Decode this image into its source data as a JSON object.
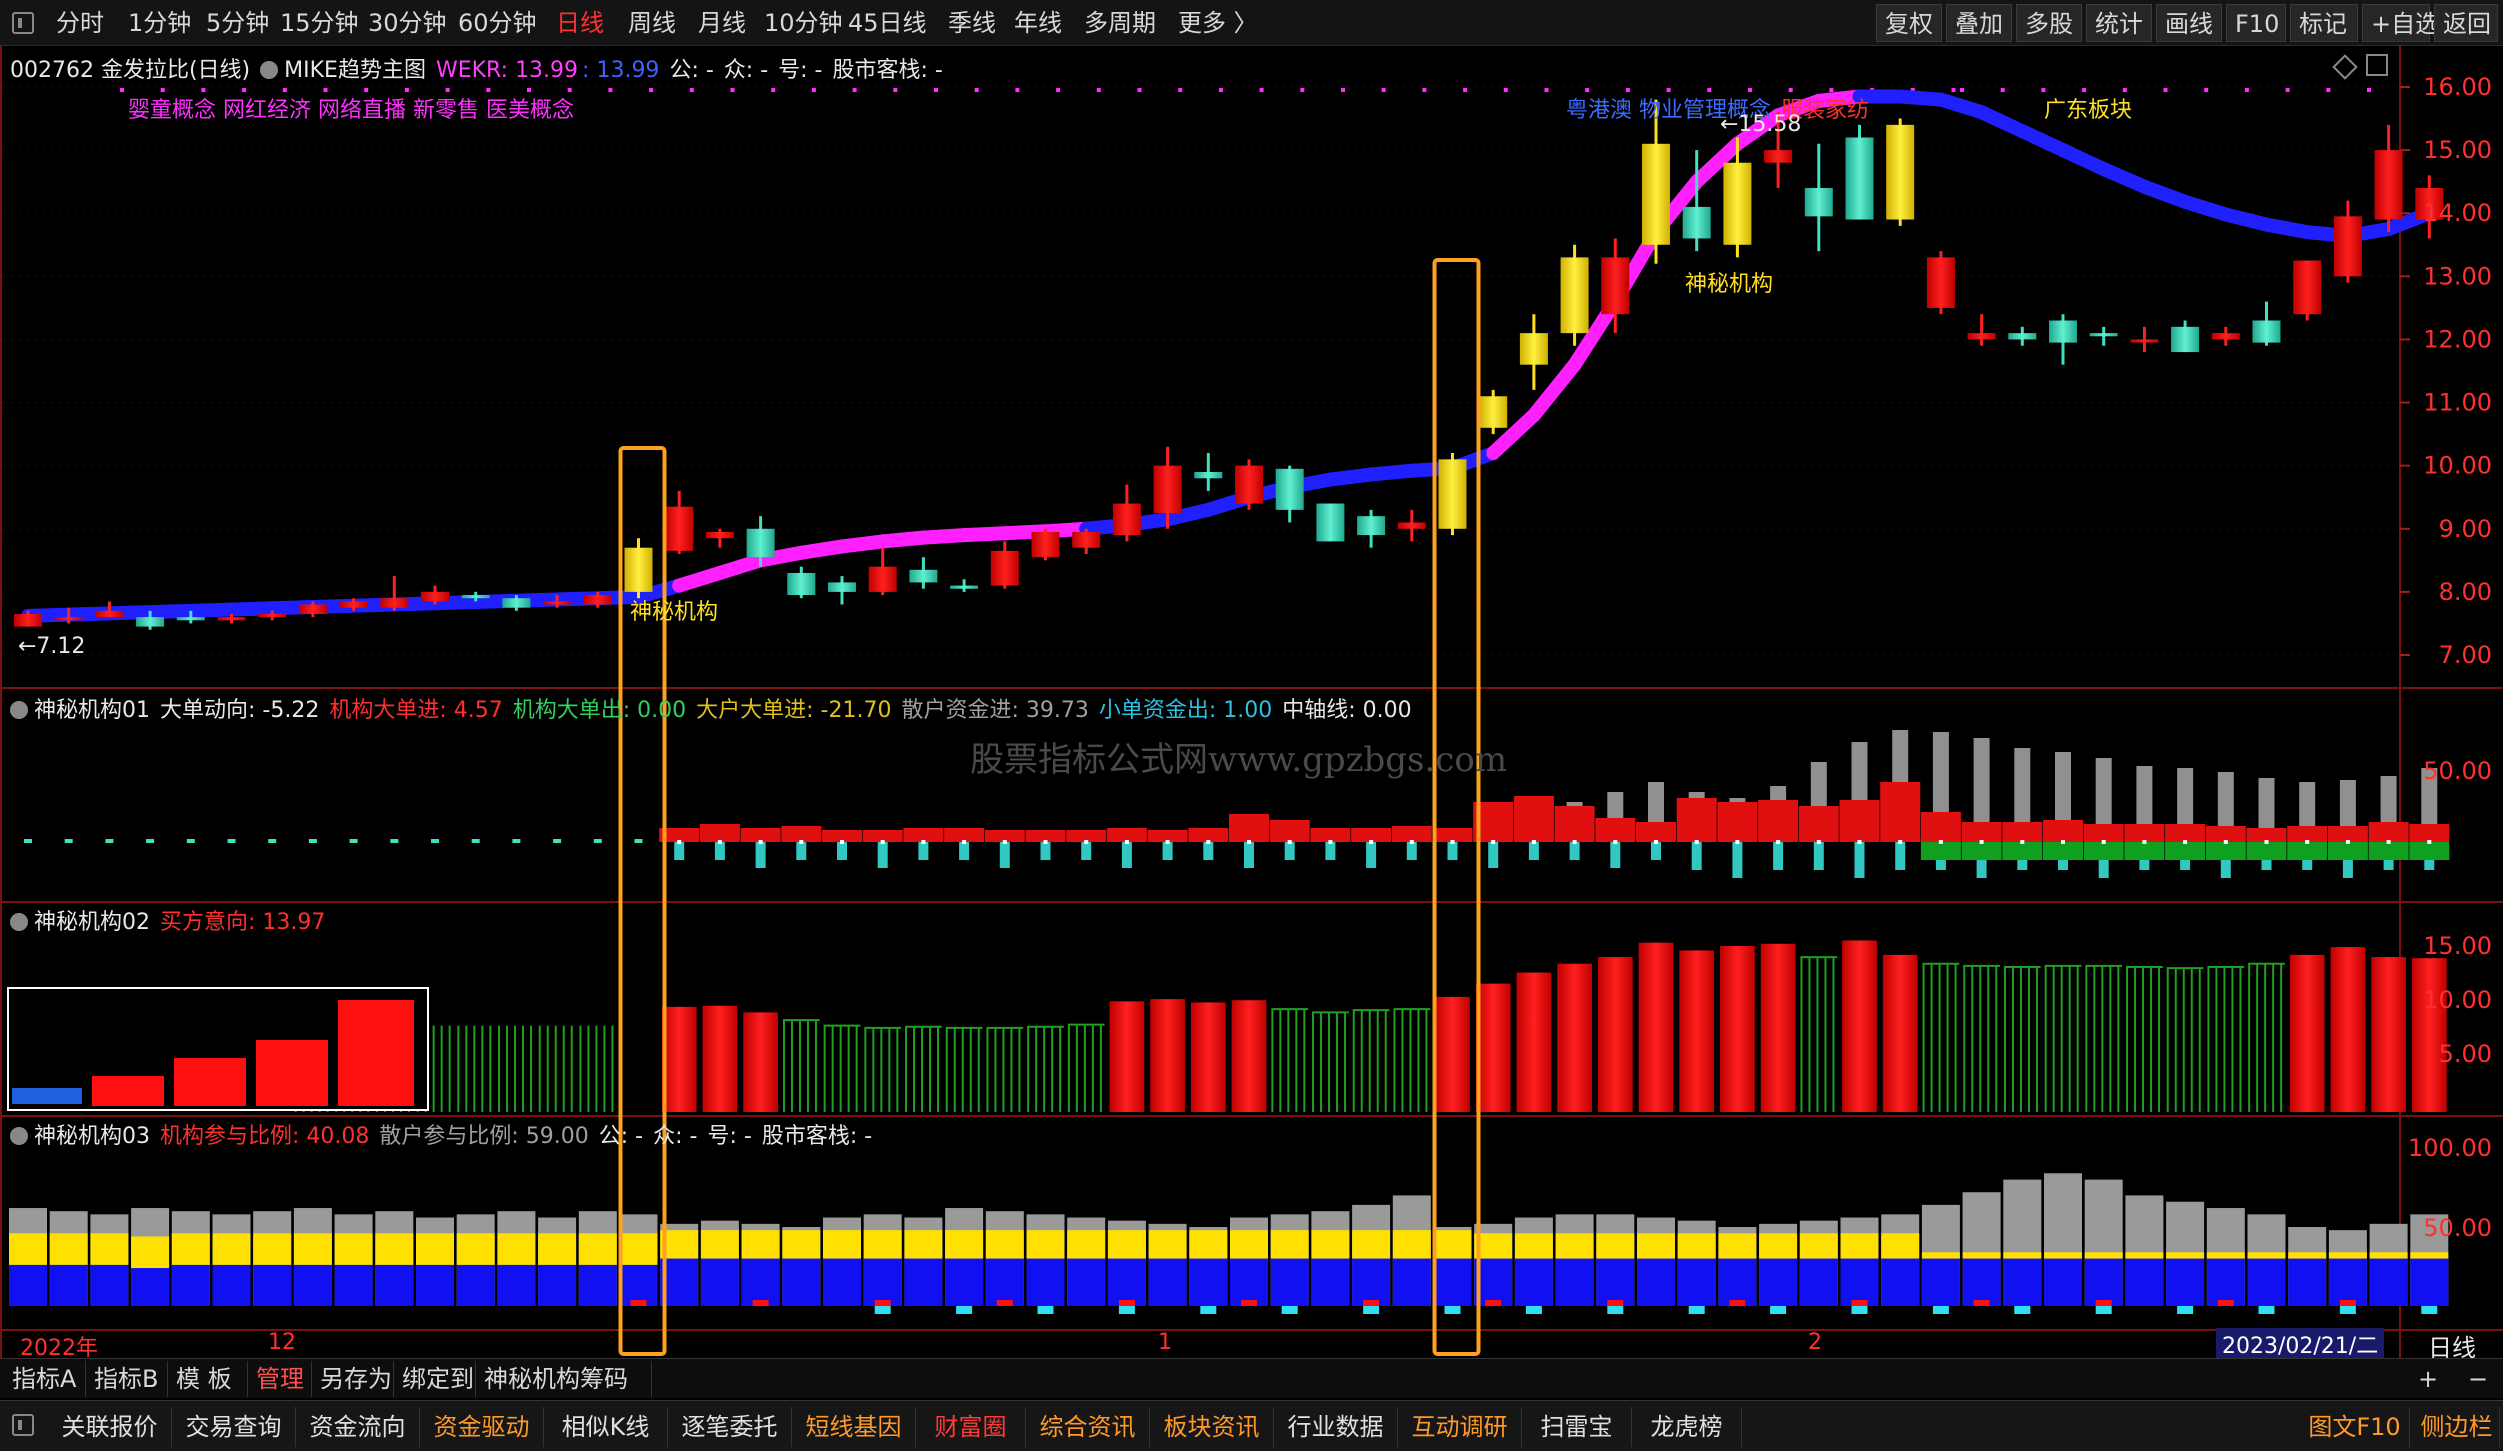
{
  "toolbar": {
    "periods": [
      "分时",
      "1分钟",
      "5分钟",
      "15分钟",
      "30分钟",
      "60分钟",
      "日线",
      "周线",
      "月线",
      "10分钟",
      "45日线",
      "季线",
      "年线",
      "多周期",
      "更多 〉"
    ],
    "active_period": "日线",
    "right_buttons": [
      "复权",
      "叠加",
      "多股",
      "统计",
      "画线",
      "F10",
      "标记",
      "+自选",
      "返回"
    ]
  },
  "main_panel": {
    "code_title": "002762 金发拉比(日线)",
    "indicator_name": "MIKE趋势主图",
    "wekr_label": "WEKR: 13.99",
    "wekr_value2": ": 13.99",
    "extra_labels": [
      "公: -",
      "众: -",
      "号: -",
      "股市客栈: -"
    ],
    "concepts_left": "婴童概念 网红经济 网络直播 新零售 医美概念",
    "concepts_right_blue": "粤港澳 物业管理概念",
    "concepts_right_red": "服装家纺",
    "concepts_right_yellow": "广东板块",
    "mark_high": "←15.58",
    "mark_low": "←7.12",
    "annotation": "神秘机构",
    "y_ticks": [
      "16.00",
      "15.00",
      "14.00",
      "13.00",
      "12.00",
      "11.00",
      "10.00",
      "9.00",
      "8.00",
      "7.00"
    ],
    "colors": {
      "up": "#ff1a1a",
      "down": "#40e0c0",
      "yellow": "#ffe020",
      "trend_blue": "#2020ff",
      "trend_magenta": "#ff20ff"
    }
  },
  "panel1": {
    "name": "神秘机构01",
    "fields": [
      {
        "label": "大单动向: -5.22",
        "color": "#e8e8e8"
      },
      {
        "label": "机构大单进: 4.57",
        "color": "#ff3030"
      },
      {
        "label": "机构大单出: 0.00",
        "color": "#30d060"
      },
      {
        "label": "大户大单进: -21.70",
        "color": "#e0c020"
      },
      {
        "label": "散户资金进: 39.73",
        "color": "#a0a0a0"
      },
      {
        "label": "小单资金出: 1.00",
        "color": "#30c0e0"
      },
      {
        "label": "中轴线: 0.00",
        "color": "#e8e8e8"
      }
    ],
    "y_ticks": [
      "50.00"
    ],
    "watermark": "股票指标公式网www.gpzbgs.com"
  },
  "panel2": {
    "name": "神秘机构02",
    "field": "买方意向: 13.97",
    "y_ticks": [
      "15.00",
      "10.00",
      "5.00"
    ]
  },
  "panel3": {
    "name": "神秘机构03",
    "fields": [
      {
        "label": "机构参与比例: 40.08",
        "color": "#ff3030"
      },
      {
        "label": "散户参与比例: 59.00",
        "color": "#a0a0a0"
      },
      {
        "label": "公: -",
        "color": "#e8e8e8"
      },
      {
        "label": "众: -",
        "color": "#e8e8e8"
      },
      {
        "label": "号: -",
        "color": "#e8e8e8"
      },
      {
        "label": "股市客栈: -",
        "color": "#e8e8e8"
      }
    ],
    "y_ticks": [
      "100.00",
      "50.00"
    ]
  },
  "time_axis": {
    "labels": [
      "2022年",
      "12",
      "1",
      "2"
    ],
    "current_date": "2023/02/21/二",
    "period": "日线"
  },
  "tabs": {
    "items": [
      "指标A",
      "指标B",
      "模 板",
      "管理",
      "另存为",
      "绑定到",
      "神秘机构筹码"
    ],
    "active": "管理"
  },
  "bottom_buttons": {
    "items": [
      {
        "label": "关联报价",
        "style": "normal"
      },
      {
        "label": "交易查询",
        "style": "normal"
      },
      {
        "label": "资金流向",
        "style": "normal"
      },
      {
        "label": "资金驱动",
        "style": "orange"
      },
      {
        "label": "相似K线",
        "style": "normal"
      },
      {
        "label": "逐笔委托",
        "style": "normal"
      },
      {
        "label": "短线基因",
        "style": "orange"
      },
      {
        "label": "财富圈",
        "style": "red"
      },
      {
        "label": "综合资讯",
        "style": "orange"
      },
      {
        "label": "板块资讯",
        "style": "orange"
      },
      {
        "label": "行业数据",
        "style": "normal"
      },
      {
        "label": "互动调研",
        "style": "orange"
      },
      {
        "label": "扫雷宝",
        "style": "normal"
      },
      {
        "label": "龙虎榜",
        "style": "normal"
      }
    ],
    "right": [
      "图文F10",
      "侧边栏"
    ]
  },
  "chart_data": {
    "type": "candlestick",
    "price_range": [
      6.6,
      16.2
    ],
    "candles": [
      [
        7.45,
        7.7,
        7.5,
        7.65
      ],
      [
        7.55,
        7.75,
        7.5,
        7.6
      ],
      [
        7.6,
        7.85,
        7.6,
        7.7
      ],
      [
        7.6,
        7.7,
        7.4,
        7.45
      ],
      [
        7.6,
        7.7,
        7.5,
        7.55
      ],
      [
        7.55,
        7.65,
        7.5,
        7.6
      ],
      [
        7.6,
        7.7,
        7.55,
        7.65
      ],
      [
        7.65,
        7.85,
        7.6,
        7.8
      ],
      [
        7.75,
        7.9,
        7.7,
        7.85
      ],
      [
        7.75,
        8.25,
        7.7,
        7.9
      ],
      [
        7.85,
        8.1,
        7.8,
        8.0
      ],
      [
        7.95,
        8.0,
        7.85,
        7.9
      ],
      [
        7.9,
        7.95,
        7.7,
        7.75
      ],
      [
        7.8,
        7.95,
        7.75,
        7.85
      ],
      [
        7.8,
        8.0,
        7.75,
        7.95
      ],
      [
        8.0,
        8.85,
        7.9,
        8.7
      ],
      [
        8.65,
        9.6,
        8.6,
        9.35
      ],
      [
        8.85,
        9.0,
        8.7,
        8.95
      ],
      [
        9.0,
        9.2,
        8.4,
        8.55
      ],
      [
        8.3,
        8.4,
        7.9,
        7.95
      ],
      [
        8.15,
        8.25,
        7.8,
        8.0
      ],
      [
        8.0,
        8.7,
        7.95,
        8.4
      ],
      [
        8.35,
        8.55,
        8.05,
        8.15
      ],
      [
        8.1,
        8.2,
        8.0,
        8.05
      ],
      [
        8.1,
        8.8,
        8.05,
        8.65
      ],
      [
        8.55,
        9.0,
        8.5,
        8.95
      ],
      [
        8.7,
        9.0,
        8.6,
        8.95
      ],
      [
        8.9,
        9.7,
        8.8,
        9.4
      ],
      [
        9.25,
        10.3,
        9.0,
        10.0
      ],
      [
        9.9,
        10.2,
        9.6,
        9.8
      ],
      [
        9.4,
        10.1,
        9.3,
        10.0
      ],
      [
        9.95,
        10.0,
        9.1,
        9.3
      ],
      [
        9.4,
        9.4,
        8.8,
        8.8
      ],
      [
        9.2,
        9.3,
        8.7,
        8.9
      ],
      [
        9.0,
        9.3,
        8.8,
        9.1
      ],
      [
        9.0,
        10.2,
        8.9,
        10.1
      ],
      [
        10.6,
        11.2,
        10.5,
        11.1
      ],
      [
        11.6,
        12.4,
        11.2,
        12.1
      ],
      [
        12.1,
        13.5,
        11.9,
        13.3
      ],
      [
        12.4,
        13.6,
        12.1,
        13.3
      ],
      [
        13.5,
        15.8,
        13.2,
        15.1
      ],
      [
        14.1,
        15.0,
        13.4,
        13.6
      ],
      [
        13.5,
        15.2,
        13.3,
        14.8
      ],
      [
        14.8,
        15.6,
        14.4,
        15.0
      ],
      [
        14.4,
        15.1,
        13.4,
        13.95
      ],
      [
        15.2,
        15.4,
        14.0,
        13.9
      ],
      [
        13.9,
        15.5,
        13.8,
        15.4
      ],
      [
        12.5,
        13.4,
        12.4,
        13.3
      ],
      [
        12.0,
        12.4,
        11.9,
        12.1
      ],
      [
        12.1,
        12.2,
        11.9,
        12.0
      ],
      [
        12.3,
        12.4,
        11.6,
        11.95
      ],
      [
        12.1,
        12.2,
        11.9,
        12.05
      ],
      [
        12.0,
        12.2,
        11.8,
        12.0
      ],
      [
        12.2,
        12.3,
        11.8,
        11.8
      ],
      [
        12.0,
        12.2,
        11.9,
        12.1
      ],
      [
        12.3,
        12.6,
        11.9,
        11.95
      ],
      [
        12.4,
        13.2,
        12.3,
        13.25
      ],
      [
        13.0,
        14.2,
        12.9,
        13.95
      ],
      [
        13.9,
        15.4,
        13.7,
        15.0
      ],
      [
        13.9,
        14.6,
        13.6,
        14.4
      ]
    ]
  }
}
